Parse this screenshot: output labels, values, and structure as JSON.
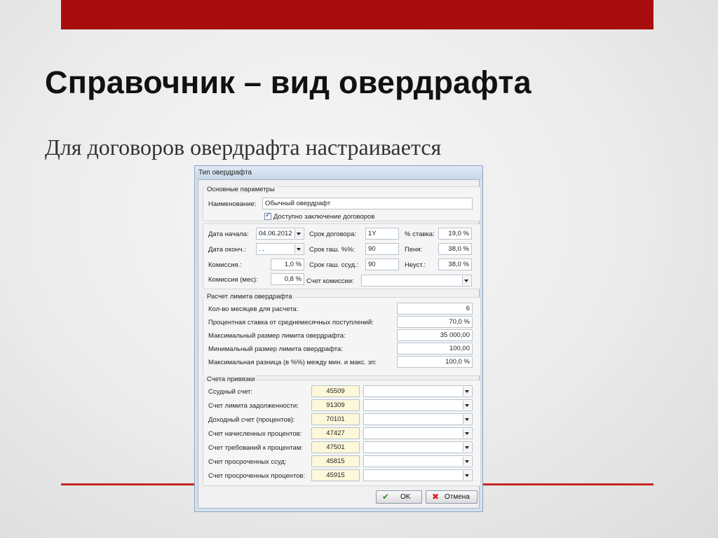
{
  "slide": {
    "title": "Справочник – вид овердрафта",
    "subtitle": "Для договоров овердрафта настраивается"
  },
  "dialog": {
    "title": "Тип овердрафта",
    "main": {
      "group_title": "Основные параметры",
      "name_label": "Наименование:",
      "name_value": "Обычный овердрафт",
      "allow_label": "Доступно заключение договоров",
      "allow_checked": true,
      "start_label": "Дата начала:",
      "start_value": "04.06.2012",
      "end_label": "Дата оконч.:",
      "end_value": " .  .",
      "commission_label": "Комиссия.:",
      "commission_value": "1,0 %",
      "commission_month_label": "Комиссия (мес):",
      "commission_month_value": "0,8 %",
      "term_label": "Срок договора:",
      "term_value": "1Y",
      "repay_pct_label": "Срок гаш. %%:",
      "repay_pct_value": "90",
      "repay_loan_label": "Срок гаш. ссуд.:",
      "repay_loan_value": "90",
      "rate_label": "% ставка:",
      "rate_value": "19,0 %",
      "penalty_label": "Пеня:",
      "penalty_value": "38,0 %",
      "forfeit_label": "Неуст.:",
      "forfeit_value": "38,0 %",
      "commission_account_label": "Счет комиссии:",
      "commission_account_value": ""
    },
    "limit": {
      "group_title": "Расчет лимита овердрафта",
      "rows": [
        {
          "label": "Кол-во месяцев для расчета:",
          "value": "6"
        },
        {
          "label": "Процентная ставка от среднемесячных поступлений:",
          "value": "70,0 %"
        },
        {
          "label": "Максимальный размер лимита овердрафта:",
          "value": "35 000,00"
        },
        {
          "label": "Минимальный размер лимита овердрафта:",
          "value": "100,00"
        },
        {
          "label": "Максимальная разница (в %%) между мин. и макс. зп:",
          "value": "100,0 %"
        }
      ]
    },
    "accounts": {
      "group_title": "Счета привязки",
      "rows": [
        {
          "label": "Ссудный счет:",
          "code": "45509",
          "value": ""
        },
        {
          "label": "Счет лимита задолженности:",
          "code": "91309",
          "value": ""
        },
        {
          "label": "Доходный счет (процентов):",
          "code": "70101",
          "value": ""
        },
        {
          "label": "Счет начисленных процентов:",
          "code": "47427",
          "value": ""
        },
        {
          "label": "Счет требований к процентам:",
          "code": "47501",
          "value": ""
        },
        {
          "label": "Счет просроченных ссуд:",
          "code": "45815",
          "value": ""
        },
        {
          "label": "Счет просроченных процентов:",
          "code": "45915",
          "value": ""
        }
      ]
    },
    "buttons": {
      "ok": "OK",
      "cancel": "Отмена"
    }
  },
  "colors": {
    "accent_red": "#a80d0d",
    "line_red": "#c42626",
    "ok_icon": "#2e8b2e",
    "cancel_icon": "#d42020"
  }
}
